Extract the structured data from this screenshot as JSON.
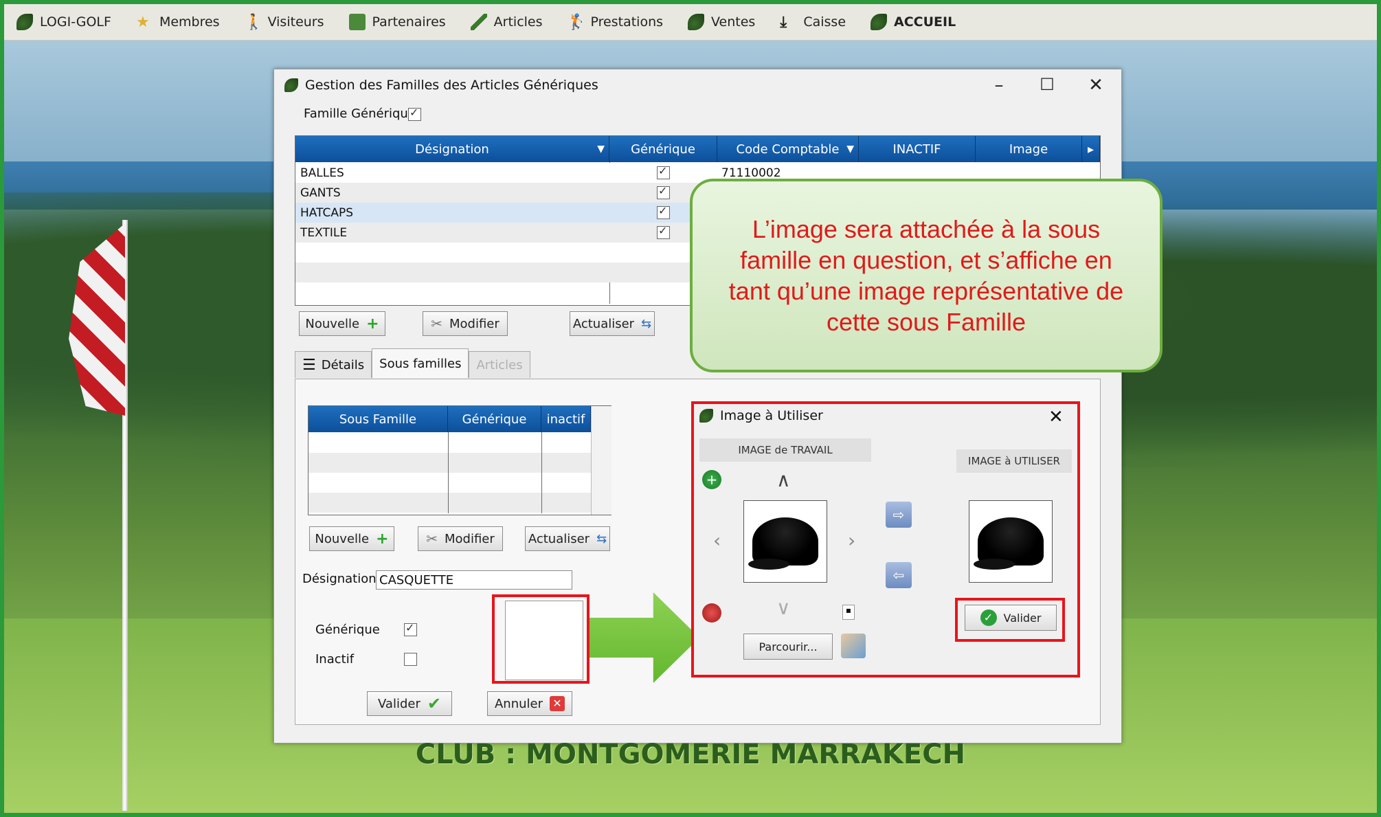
{
  "topbar": {
    "items": [
      {
        "label": "LOGI-GOLF",
        "icon": "leaf-icon"
      },
      {
        "label": "Membres",
        "icon": "star-icon"
      },
      {
        "label": "Visiteurs",
        "icon": "walker-icon"
      },
      {
        "label": "Partenaires",
        "icon": "partner-icon"
      },
      {
        "label": "Articles",
        "icon": "club-icon"
      },
      {
        "label": "Prestations",
        "icon": "golfer-icon"
      },
      {
        "label": "Ventes",
        "icon": "cart-icon"
      },
      {
        "label": "Caisse",
        "icon": "download-icon"
      },
      {
        "label": "ACCUEIL",
        "icon": "leaf-icon"
      }
    ]
  },
  "window": {
    "title": "Gestion des Familles des Articles Génériques",
    "famille_generique_label": "Famille Générique",
    "famille_generique_checked": true,
    "minimize": "–",
    "maximize": "☐",
    "close": "✕"
  },
  "grid": {
    "columns": [
      "Désignation",
      "Générique",
      "Code Comptable",
      "INACTIF",
      "Image"
    ],
    "rows": [
      {
        "designation": "BALLES",
        "generique": true,
        "code": "71110002"
      },
      {
        "designation": "GANTS",
        "generique": true,
        "code": ""
      },
      {
        "designation": "HATCAPS",
        "generique": true,
        "code": ""
      },
      {
        "designation": "TEXTILE",
        "generique": true,
        "code": ""
      }
    ]
  },
  "buttons": {
    "nouvelle": "Nouvelle",
    "modifier": "Modifier",
    "actualiser": "Actualiser",
    "valider": "Valider",
    "annuler": "Annuler"
  },
  "tabs": {
    "details": "Détails",
    "sous_familles": "Sous familles",
    "articles": "Articles"
  },
  "subgrid": {
    "columns": [
      "Sous Famille",
      "Générique",
      "inactif"
    ]
  },
  "form": {
    "designation_label": "Désignation",
    "designation_value": "CASQUETTE",
    "generique_label": "Générique",
    "generique_checked": true,
    "inactif_label": "Inactif",
    "inactif_checked": false
  },
  "dialog": {
    "title": "Image à Utiliser",
    "close": "✕",
    "image_travail": "IMAGE de TRAVAIL",
    "image_utiliser": "IMAGE à UTILISER",
    "parcourir": "Parcourir...",
    "valider": "Valider"
  },
  "tooltip": {
    "text": "L’image sera attachée à la sous famille en question, et s’affiche en tant qu’une image représentative de cette sous Famille"
  },
  "footer": {
    "club": "CLUB : MONTGOMERIE MARRAKECH"
  },
  "colors": {
    "frame": "#2a9a3a",
    "grid_header": "#1e6fc0",
    "highlight": "#e8141b",
    "tooltip_text": "#e01a1a",
    "arrow": "#63b72e"
  }
}
